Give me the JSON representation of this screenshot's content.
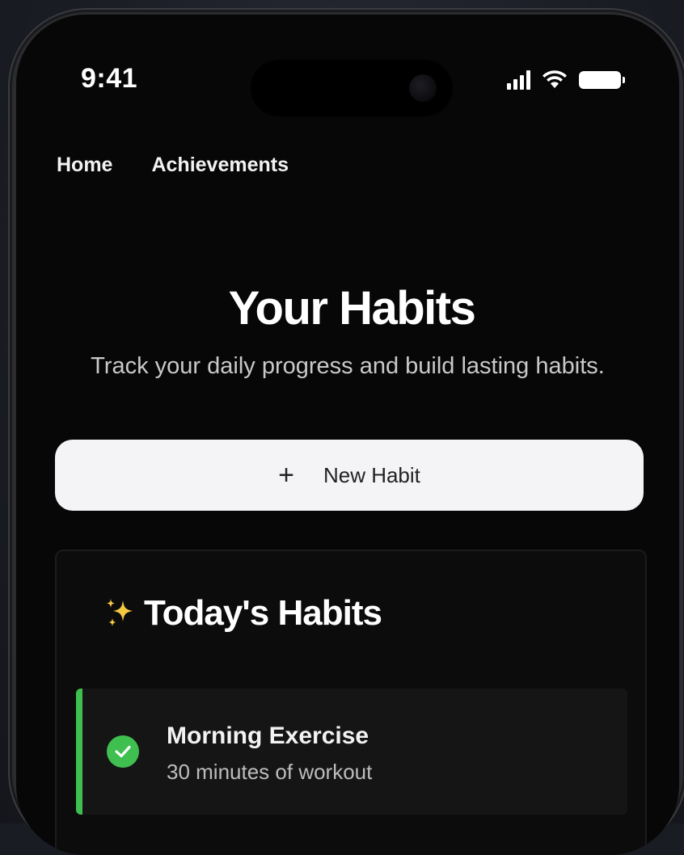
{
  "status_bar": {
    "time": "9:41",
    "icons": [
      "cellular-signal-icon",
      "wifi-icon",
      "battery-icon"
    ]
  },
  "nav": {
    "items": [
      {
        "label": "Home"
      },
      {
        "label": "Achievements"
      }
    ]
  },
  "hero": {
    "title": "Your Habits",
    "subtitle": "Track your daily progress and build lasting habits."
  },
  "new_habit_button": {
    "icon": "plus-icon",
    "label": "New Habit"
  },
  "todays_habits": {
    "icon": "sparkles-icon",
    "title": "Today's Habits",
    "items": [
      {
        "name": "Morning Exercise",
        "description": "30 minutes of workout",
        "completed": true,
        "status_icon": "check-circle-icon"
      }
    ]
  },
  "colors": {
    "background": "#070707",
    "accent_green": "#3fbf4f",
    "button_bg": "#f4f4f6",
    "text_primary": "#ffffff",
    "text_secondary": "#c9c9c9"
  }
}
